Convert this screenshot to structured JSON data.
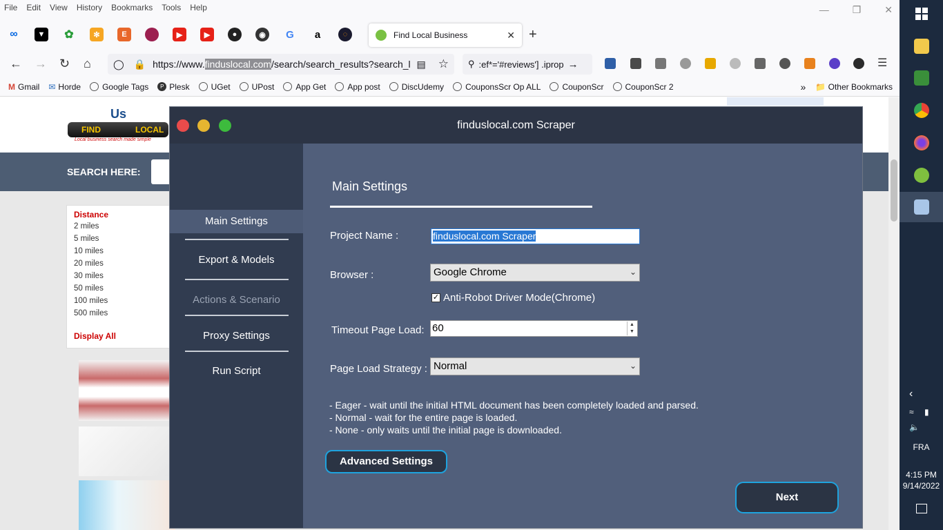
{
  "menu": [
    "File",
    "Edit",
    "View",
    "History",
    "Bookmarks",
    "Tools",
    "Help"
  ],
  "tab": {
    "title": "Find Local Business"
  },
  "url": {
    "prefix": "https://www.",
    "highlight": "finduslocal.com",
    "rest": "/search/search_results?search_loca"
  },
  "search_text": ":ef*='#reviews'] .iprop",
  "bookmarks": [
    "Gmail",
    "Horde",
    "Google Tags",
    "Plesk",
    "UGet",
    "UPost",
    "App Get",
    "App post",
    "DiscUdemy",
    "CouponsScr Op ALL",
    "CouponScr",
    "CouponScr 2"
  ],
  "other_bookmarks": "Other Bookmarks",
  "webpage": {
    "logo_us": "Us",
    "logo_find": "FIND",
    "logo_local": "LOCAL",
    "logo_tag": "Local business   search made simple",
    "search_label": "SEARCH HERE:",
    "filter_head": "Distance",
    "filter_items": [
      "2 miles",
      "5 miles",
      "10 miles",
      "20 miles",
      "30 miles",
      "50 miles",
      "100 miles",
      "500 miles"
    ],
    "display_all": "Display All"
  },
  "app": {
    "title": "finduslocal.com Scraper",
    "nav": [
      "Main Settings",
      "Export & Models",
      "Actions & Scenario",
      "Proxy Settings",
      "Run Script"
    ],
    "heading": "Main Settings",
    "project_label": "Project Name :",
    "project_value": "finduslocal.com Scraper",
    "browser_label": "Browser :",
    "browser_value": "Google Chrome",
    "antirobot_label": "Anti-Robot Driver Mode(Chrome)",
    "antirobot_checked": true,
    "timeout_label": "Timeout Page Load:",
    "timeout_value": "60",
    "strategy_label": "Page Load Strategy :",
    "strategy_value": "Normal",
    "notes": [
      "- Eager - wait until the initial HTML document has been completely loaded and parsed.",
      "- Normal - wait for the entire page is loaded.",
      "- None - only waits until the initial page is downloaded."
    ],
    "advanced_button": "Advanced Settings",
    "next_button": "Next"
  },
  "taskbar": {
    "lang": "FRA",
    "time": "4:15 PM",
    "date": "9/14/2022"
  },
  "colors": {
    "accent": "#1ea3de",
    "app_bg": "#515f7b",
    "sidebar_bg": "#313c50",
    "title_bg": "#2c3445",
    "close": "#e94b4b",
    "minimize": "#e6b530",
    "maximize": "#3dbb3d"
  }
}
